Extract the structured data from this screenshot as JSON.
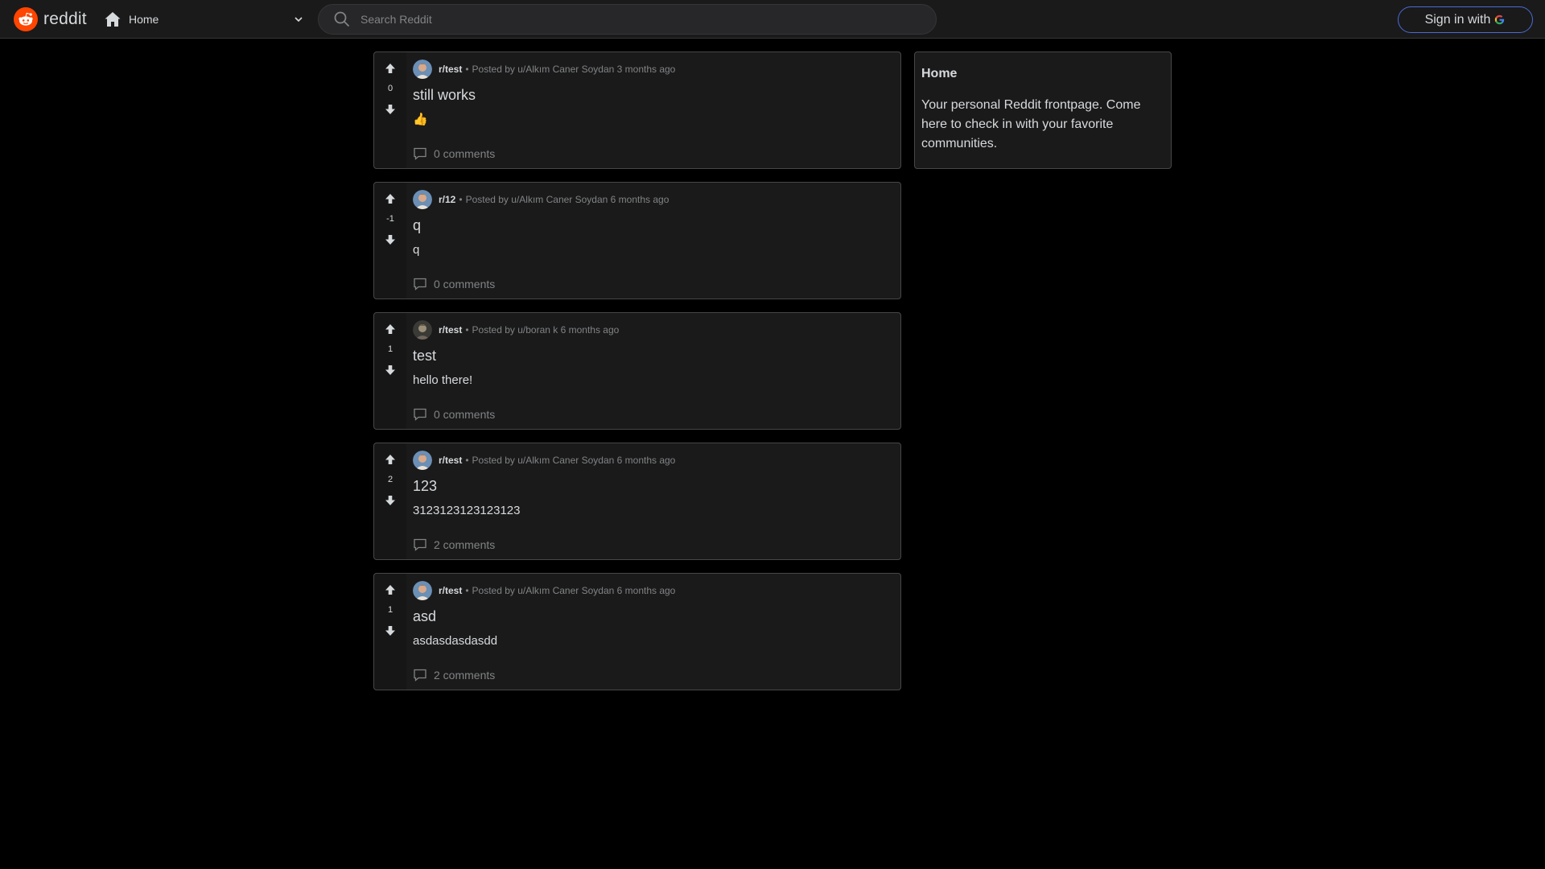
{
  "header": {
    "logo_text": "reddit",
    "home_label": "Home",
    "search_placeholder": "Search Reddit",
    "signin_label": "Sign in with"
  },
  "colors": {
    "brand": "#ff4500",
    "background": "#000000",
    "card": "#1a1a1b",
    "border": "#474748",
    "muted": "#818384",
    "signin_border": "#4a6cd4"
  },
  "posts": [
    {
      "score": "0",
      "subreddit": "r/test",
      "posted_by": "Posted by u/Alkım Caner Soydan 3 months ago",
      "title": "still works",
      "body": "👍",
      "comments": "0 comments",
      "avatar": "user-avatar-icon"
    },
    {
      "score": "-1",
      "subreddit": "r/12",
      "posted_by": "Posted by u/Alkım Caner Soydan 6 months ago",
      "title": "q",
      "body": "q",
      "comments": "0 comments",
      "avatar": "user-avatar-icon"
    },
    {
      "score": "1",
      "subreddit": "r/test",
      "posted_by": "Posted by u/boran k 6 months ago",
      "title": "test",
      "body": "hello there!",
      "comments": "0 comments",
      "avatar": "user-avatar-icon"
    },
    {
      "score": "2",
      "subreddit": "r/test",
      "posted_by": "Posted by u/Alkım Caner Soydan 6 months ago",
      "title": "123",
      "body": "3123123123123123",
      "comments": "2 comments",
      "avatar": "user-avatar-icon"
    },
    {
      "score": "1",
      "subreddit": "r/test",
      "posted_by": "Posted by u/Alkım Caner Soydan 6 months ago",
      "title": "asd",
      "body": "asdasdasdasdd",
      "comments": "2 comments",
      "avatar": "user-avatar-icon"
    }
  ],
  "sidebar": {
    "title": "Home",
    "description": "Your personal Reddit frontpage. Come here to check in with your favorite communities."
  }
}
